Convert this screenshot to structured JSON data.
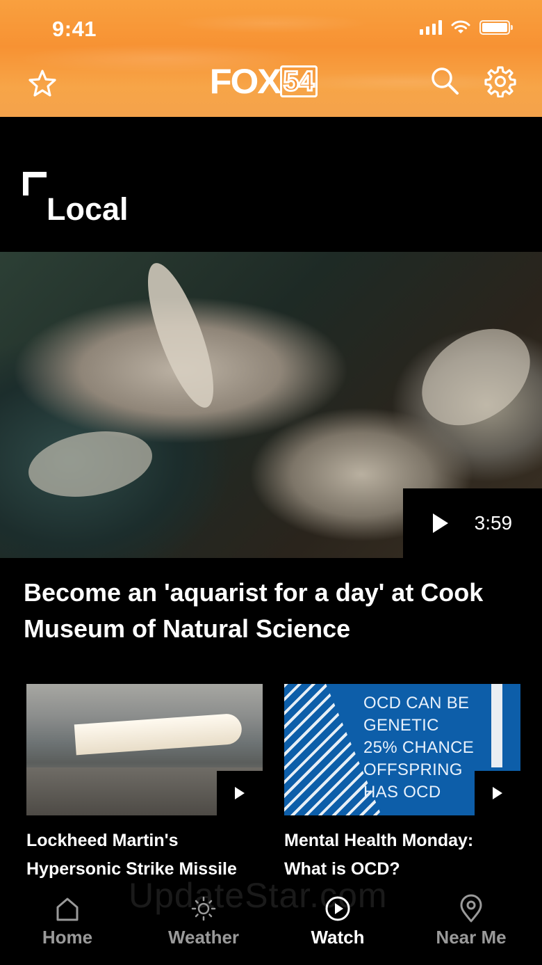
{
  "status_bar": {
    "time": "9:41"
  },
  "header": {
    "logo_text": "FOX",
    "logo_number": "54",
    "icons": [
      "star-icon",
      "search-icon",
      "gear-icon"
    ]
  },
  "section": {
    "title": "Local"
  },
  "hero": {
    "duration": "3:59",
    "title": "Become an 'aquarist for a day' at Cook Museum of Natural Science"
  },
  "cards": [
    {
      "title_line1": "Lockheed Martin's",
      "title_line2": "Hypersonic Strike Missile"
    },
    {
      "title_line1": "Mental Health Monday:",
      "title_line2": "What is OCD?",
      "image_text": [
        "OCD CAN BE",
        "GENETIC",
        "25% CHANCE",
        "OFFSPRING",
        "HAS OCD"
      ]
    }
  ],
  "watermark": "UpdateStar.com",
  "tabs": [
    {
      "label": "Home",
      "icon": "home-icon",
      "active": false
    },
    {
      "label": "Weather",
      "icon": "sun-icon",
      "active": false
    },
    {
      "label": "Watch",
      "icon": "play-circle-icon",
      "active": true
    },
    {
      "label": "Near Me",
      "icon": "location-pin-icon",
      "active": false
    }
  ],
  "colors": {
    "header_orange": "#f79233",
    "background": "#000000",
    "inactive_tab": "#9a9a9a",
    "ocd_blue": "#0d5ea9"
  }
}
